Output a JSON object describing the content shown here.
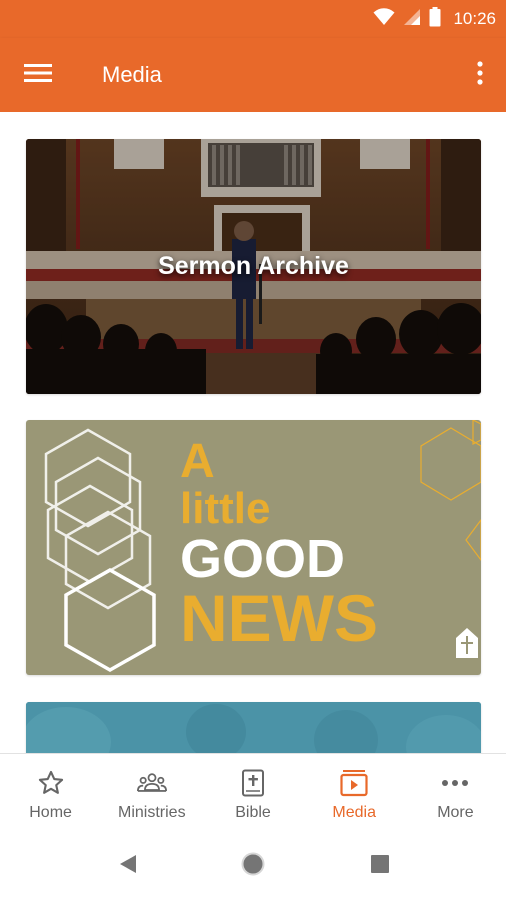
{
  "status_bar": {
    "time": "10:26"
  },
  "app_bar": {
    "title": "Media"
  },
  "cards": [
    {
      "title": "Sermon Archive"
    },
    {
      "line1": "A",
      "line2": "little",
      "line3": "GOOD",
      "line4": "NEWS"
    }
  ],
  "bottom_nav": {
    "items": [
      {
        "label": "Home",
        "icon": "star-icon"
      },
      {
        "label": "Ministries",
        "icon": "people-icon"
      },
      {
        "label": "Bible",
        "icon": "bible-icon"
      },
      {
        "label": "Media",
        "icon": "media-icon"
      },
      {
        "label": "More",
        "icon": "more-dots-icon"
      }
    ],
    "active_index": 3
  },
  "colors": {
    "brand": "#e8692a",
    "inactive": "#666666",
    "news_gold": "#e9ad2f",
    "news_bg": "#9a9776"
  }
}
